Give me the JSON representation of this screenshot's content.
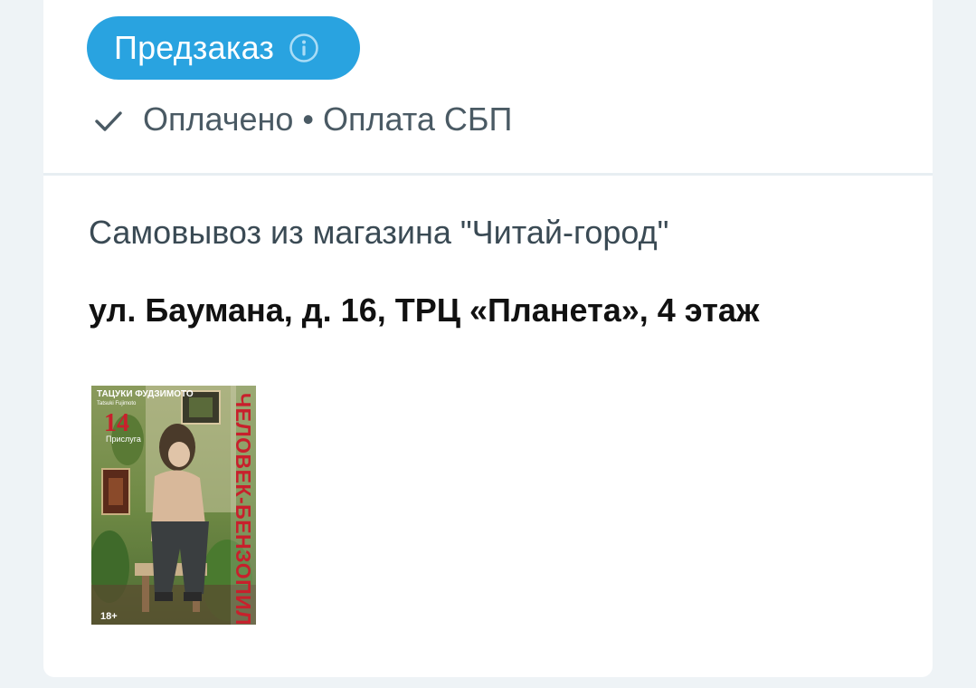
{
  "order": {
    "badge_label": "Предзаказ",
    "status_paid": "Оплачено",
    "separator": "•",
    "payment_method": "Оплата СБП",
    "delivery_title": "Самовывоз из магазина \"Читай-город\"",
    "address": "ул. Баумана, д. 16, ТРЦ «Планета», 4 этаж"
  },
  "product": {
    "cover_author": "ТАЦУКИ ФУДЗИМОТО",
    "cover_author_latin": "Tatsuki Fujimoto",
    "cover_volume": "14",
    "cover_subtitle": "Прислуга",
    "cover_title": "ЧЕЛОВЕК-БЕНЗОПИЛА",
    "age_rating": "18+"
  },
  "colors": {
    "badge_bg": "#29a3e0",
    "page_bg": "#eef3f6",
    "card_bg": "#ffffff",
    "title_red": "#c8202c"
  },
  "icons": {
    "info": "info-circle-icon",
    "check": "check-icon"
  }
}
